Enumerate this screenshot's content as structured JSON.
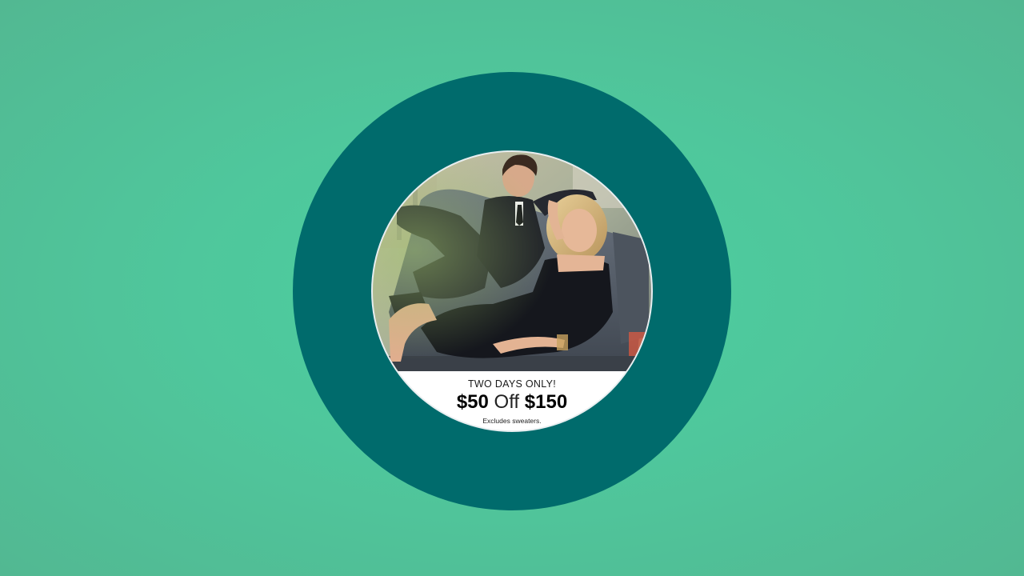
{
  "colors": {
    "background": "#4fc79c",
    "ring": "#006b6c",
    "promo_panel": "#ffffff"
  },
  "promo": {
    "kicker": "TWO DAYS ONLY!",
    "offer_amount": "$50",
    "offer_word": "Off",
    "offer_threshold": "$150",
    "note": "Excludes sweaters."
  },
  "image": {
    "subject": "fashion-couple-on-sofa-photo"
  }
}
